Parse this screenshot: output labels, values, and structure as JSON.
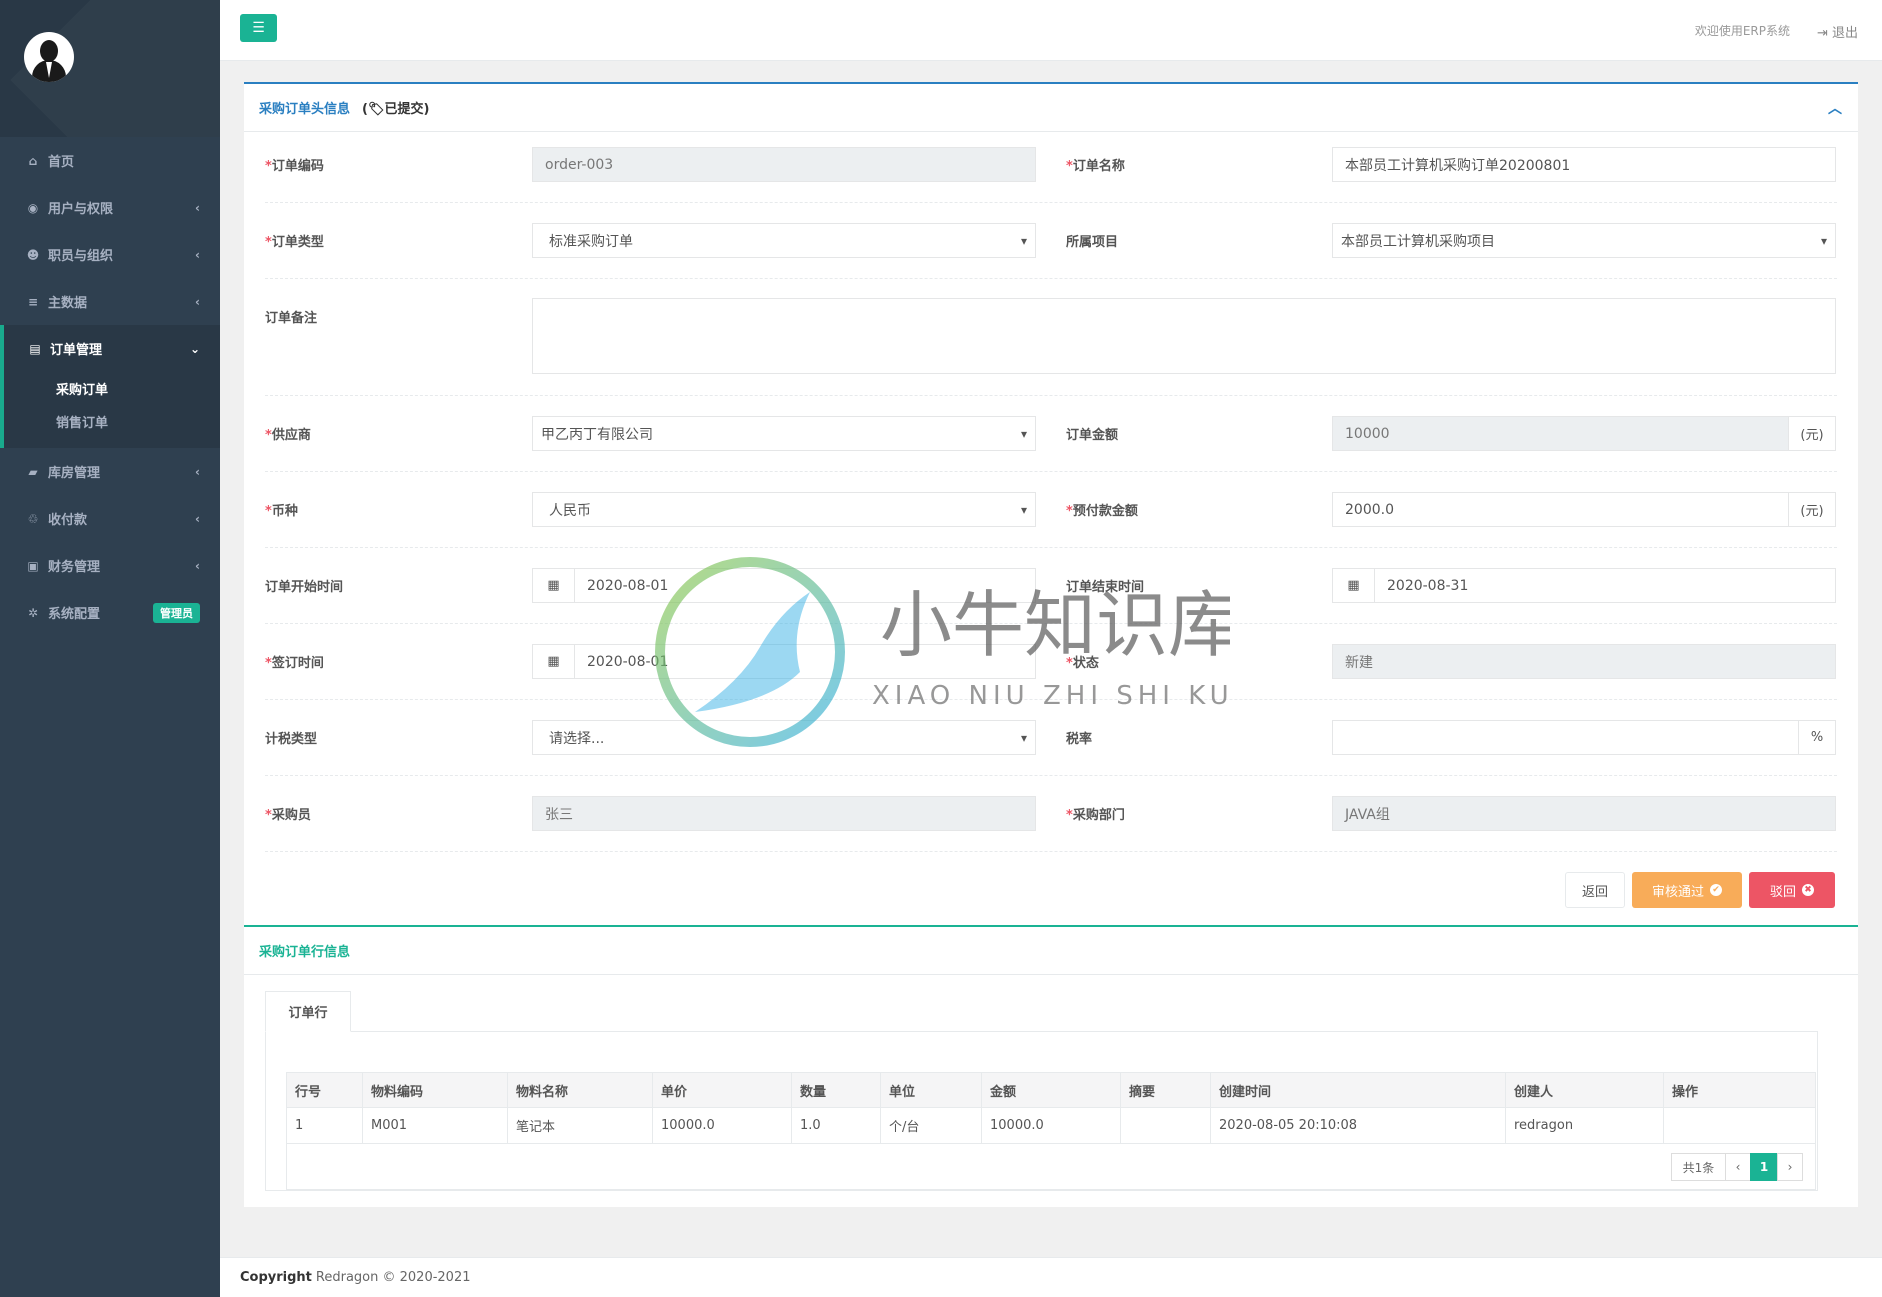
{
  "sidebar": {
    "items": [
      {
        "label": "首页"
      },
      {
        "label": "用户与权限"
      },
      {
        "label": "职员与组织"
      },
      {
        "label": "主数据"
      },
      {
        "label": "订单管理"
      },
      {
        "label": "库房管理"
      },
      {
        "label": "收付款"
      },
      {
        "label": "财务管理"
      },
      {
        "label": "系统配置"
      }
    ],
    "sub_items": [
      {
        "label": "采购订单"
      },
      {
        "label": "销售订单"
      }
    ],
    "admin_badge": "管理员"
  },
  "topbar": {
    "welcome": "欢迎使用ERP系统",
    "logout": "退出"
  },
  "header_panel": {
    "title": "采购订单头信息",
    "status": "(🏷已提交)"
  },
  "form": {
    "order_code_label": "订单编码",
    "order_code": "order-003",
    "order_name_label": "订单名称",
    "order_name": "本部员工计算机采购订单20200801",
    "order_type_label": "订单类型",
    "order_type": "标准采购订单",
    "project_label": "所属项目",
    "project": "本部员工计算机采购项目",
    "remark_label": "订单备注",
    "remark": "",
    "supplier_label": "供应商",
    "supplier": "甲乙丙丁有限公司",
    "amount_label": "订单金额",
    "amount": "10000",
    "amount_unit": "(元)",
    "currency_label": "币种",
    "currency": "人民币",
    "prepay_label": "预付款金额",
    "prepay": "2000.0",
    "prepay_unit": "(元)",
    "start_label": "订单开始时间",
    "start": "2020-08-01",
    "end_label": "订单结束时间",
    "end": "2020-08-31",
    "sign_label": "签订时间",
    "sign": "2020-08-01",
    "status_label": "状态",
    "status": "新建",
    "tax_type_label": "计税类型",
    "tax_type": "请选择...",
    "tax_rate_label": "税率",
    "tax_rate": "",
    "tax_rate_unit": "%",
    "buyer_label": "采购员",
    "buyer": "张三",
    "dept_label": "采购部门",
    "dept": "JAVA组"
  },
  "actions": {
    "back": "返回",
    "approve": "审核通过",
    "reject": "驳回"
  },
  "lines_panel": {
    "title": "采购订单行信息",
    "tab": "订单行",
    "columns": [
      "行号",
      "物料编码",
      "物料名称",
      "单价",
      "数量",
      "单位",
      "金额",
      "摘要",
      "创建时间",
      "创建人",
      "操作"
    ],
    "rows": [
      [
        "1",
        "M001",
        "笔记本",
        "10000.0",
        "1.0",
        "个/台",
        "10000.0",
        "",
        "2020-08-05 20:10:08",
        "redragon",
        ""
      ]
    ],
    "pager": {
      "total": "共1条",
      "prev": "‹",
      "page": "1",
      "next": "›"
    }
  },
  "footer": {
    "copyright": "Copyright",
    "text": "Redragon © 2020-2021"
  },
  "watermark": {
    "cn": "小牛知识库",
    "en": "XIAO NIU ZHI SHI KU"
  },
  "colors": {
    "sidebar": "#2f4050",
    "primary": "#1ab394",
    "warning": "#f8ac59",
    "danger": "#ed5565",
    "link": "#2a7fc1"
  }
}
